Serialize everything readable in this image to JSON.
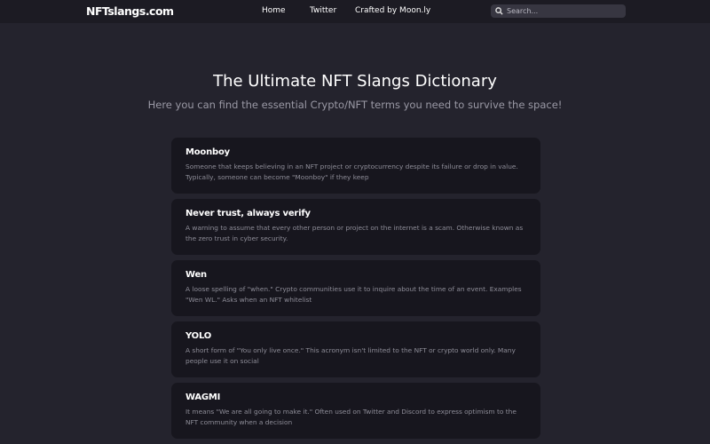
{
  "header": {
    "logo": "NFTslangs.com",
    "nav": [
      "Home",
      "Twitter",
      "Crafted by Moon.ly"
    ],
    "search_placeholder": "Search..."
  },
  "hero": {
    "title": "The Ultimate NFT Slangs Dictionary",
    "subtitle": "Here you can find the essential Crypto/NFT terms you need to survive the space!"
  },
  "terms": [
    {
      "title": "Moonboy",
      "desc": "Someone that keeps believing in an NFT project or cryptocurrency despite its failure or drop in value. Typically, someone can become \"Moonboy\" if they keep"
    },
    {
      "title": "Never trust, always verify",
      "desc": "A warning to assume that every other person or project on the internet is a scam. Otherwise known as the zero trust in cyber security."
    },
    {
      "title": "Wen",
      "desc": "A loose spelling of \"when.\" Crypto communities use it to inquire about the time of an event. Examples \"Wen WL.\" Asks when an NFT whitelist"
    },
    {
      "title": "YOLO",
      "desc": "A short form of \"You only live once.\" This acronym isn't limited to the NFT or crypto world only. Many people use it on social"
    },
    {
      "title": "WAGMI",
      "desc": "It means \"We are all going to make it.\" Often used on Twitter and Discord to express optimism to the NFT community when a decision"
    }
  ]
}
